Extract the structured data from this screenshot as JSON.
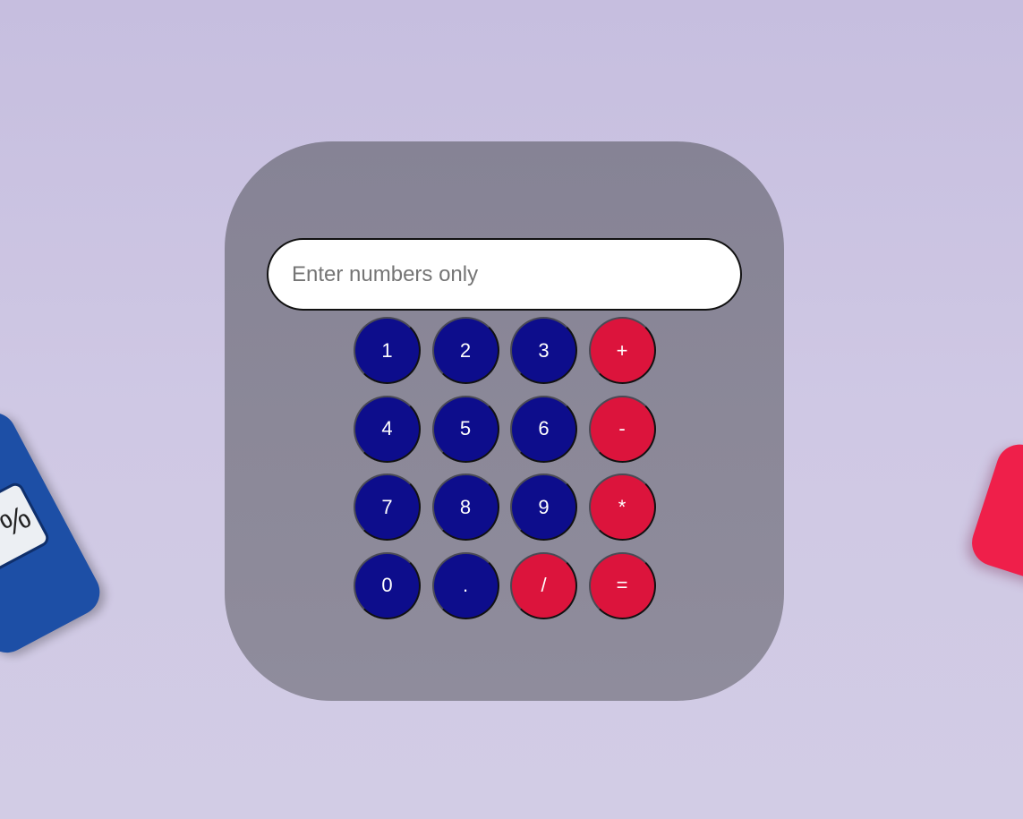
{
  "decor": {
    "left_prop_key_label": "%"
  },
  "display": {
    "value": "",
    "placeholder": "Enter numbers only"
  },
  "keypad": {
    "keys": [
      {
        "label": "1",
        "kind": "num"
      },
      {
        "label": "2",
        "kind": "num"
      },
      {
        "label": "3",
        "kind": "num"
      },
      {
        "label": "+",
        "kind": "op"
      },
      {
        "label": "4",
        "kind": "num"
      },
      {
        "label": "5",
        "kind": "num"
      },
      {
        "label": "6",
        "kind": "num"
      },
      {
        "label": "-",
        "kind": "op"
      },
      {
        "label": "7",
        "kind": "num"
      },
      {
        "label": "8",
        "kind": "num"
      },
      {
        "label": "9",
        "kind": "num"
      },
      {
        "label": "*",
        "kind": "op"
      },
      {
        "label": "0",
        "kind": "num"
      },
      {
        "label": ".",
        "kind": "num"
      },
      {
        "label": "/",
        "kind": "op"
      },
      {
        "label": "=",
        "kind": "op"
      }
    ]
  },
  "colors": {
    "number_key": "#0d0d8c",
    "operator_key": "#dc143c",
    "card": "#8a8798",
    "background": "#cbc4e2"
  }
}
